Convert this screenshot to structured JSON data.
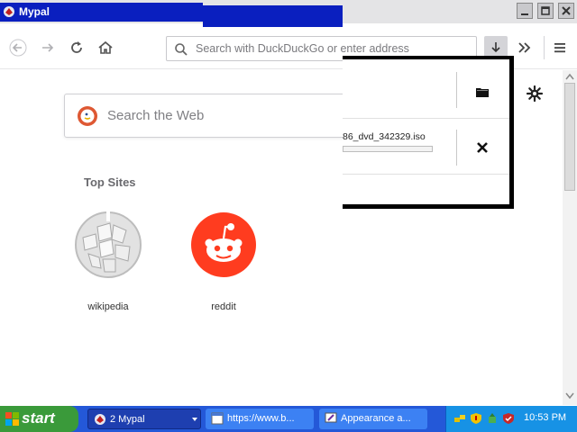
{
  "window": {
    "title": "Mypal"
  },
  "navbar": {
    "url_placeholder": "Search with DuckDuckGo or enter address"
  },
  "newtab": {
    "search_placeholder": "Search the Web",
    "top_sites_title": "Top Sites",
    "sites": [
      {
        "label": "wikipedia",
        "icon": "wikipedia-icon"
      },
      {
        "label": "reddit",
        "icon": "reddit-icon"
      }
    ]
  },
  "downloads": {
    "file_name": "86_dvd_342329.iso",
    "progress": 0
  },
  "taskbar": {
    "start_label": "start",
    "tasks": [
      {
        "label": "2 Mypal"
      },
      {
        "label": "https://www.b..."
      },
      {
        "label": "Appearance a..."
      }
    ],
    "clock": "10:53 PM"
  },
  "colors": {
    "titlebar_blue": "#0a1fbf",
    "taskbar_blue": "#2458d8",
    "start_green": "#3a9a3a",
    "reddit_red": "#ff3c1f"
  }
}
